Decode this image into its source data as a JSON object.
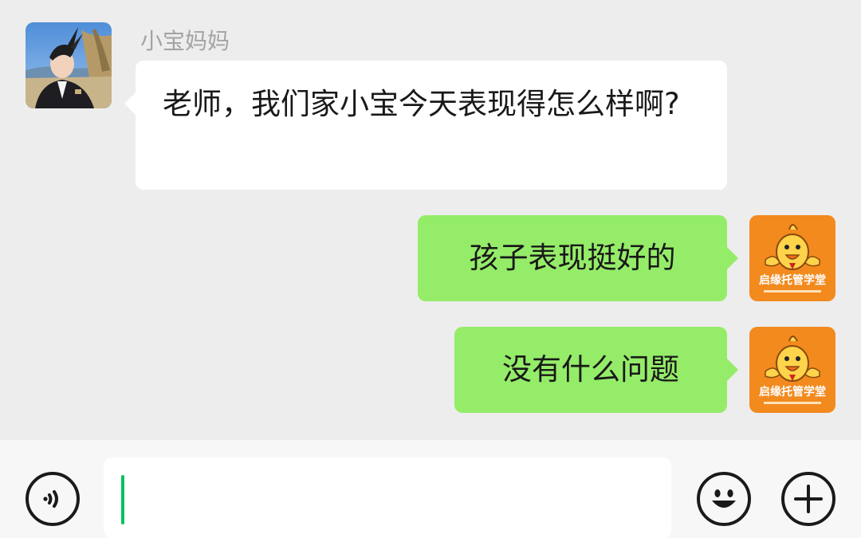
{
  "chat": {
    "messages": [
      {
        "side": "left",
        "sender": "小宝妈妈",
        "text": "老师，我们家小宝今天表现得怎么样啊?"
      },
      {
        "side": "right",
        "text": "孩子表现挺好的"
      },
      {
        "side": "right",
        "text": "没有什么问题"
      }
    ]
  },
  "avatars": {
    "right_logo_text": "启缘托管学堂"
  },
  "input": {
    "value": "",
    "voice_icon": "voice-icon",
    "emoji_icon": "emoji-icon",
    "plus_icon": "plus-icon"
  },
  "colors": {
    "background": "#ededed",
    "bubble_self": "#95ec69",
    "bubble_other": "#ffffff",
    "caret": "#07c160",
    "logo_orange": "#f28a1e"
  }
}
